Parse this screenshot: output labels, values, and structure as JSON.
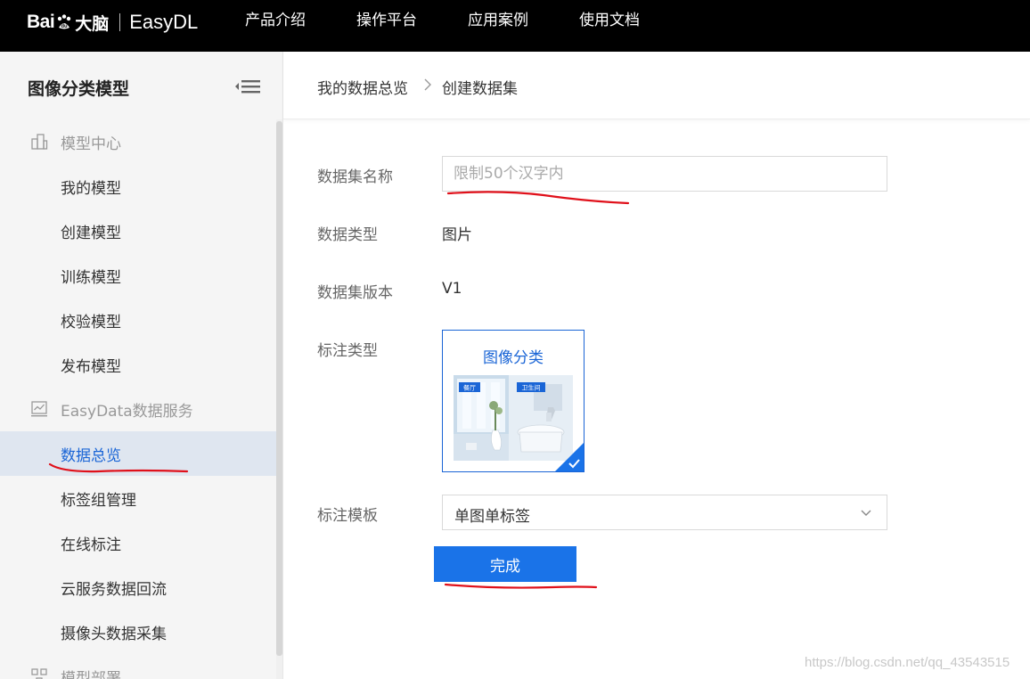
{
  "header": {
    "brand_bai": "Bai",
    "brand_cn": "大脑",
    "brand_product": "EasyDL",
    "nav": [
      "产品介绍",
      "操作平台",
      "应用案例",
      "使用文档"
    ]
  },
  "sidebar": {
    "title": "图像分类模型",
    "groups": [
      {
        "label": "模型中心",
        "icon": "building-icon"
      },
      {
        "label": "EasyData数据服务",
        "icon": "chart-icon"
      },
      {
        "label": "模型部署",
        "icon": "deploy-icon"
      }
    ],
    "model_items": [
      "我的模型",
      "创建模型",
      "训练模型",
      "校验模型",
      "发布模型"
    ],
    "data_items": [
      "数据总览",
      "标签组管理",
      "在线标注",
      "云服务数据回流",
      "摄像头数据采集"
    ],
    "active_item": "数据总览"
  },
  "breadcrumb": {
    "parent": "我的数据总览",
    "current": "创建数据集"
  },
  "form": {
    "name_label": "数据集名称",
    "name_placeholder": "限制50个汉字内",
    "type_label": "数据类型",
    "type_value": "图片",
    "version_label": "数据集版本",
    "version_value": "V1",
    "annotation_type_label": "标注类型",
    "annotation_card_title": "图像分类",
    "card_tag_left": "餐厅",
    "card_tag_right": "卫生间",
    "template_label": "标注模板",
    "template_value": "单图单标签",
    "submit_label": "完成"
  },
  "colors": {
    "accent": "#1a65d6",
    "button": "#1a73e8",
    "annotation_red": "#e0101a"
  },
  "watermark": "https://blog.csdn.net/qq_43543515"
}
